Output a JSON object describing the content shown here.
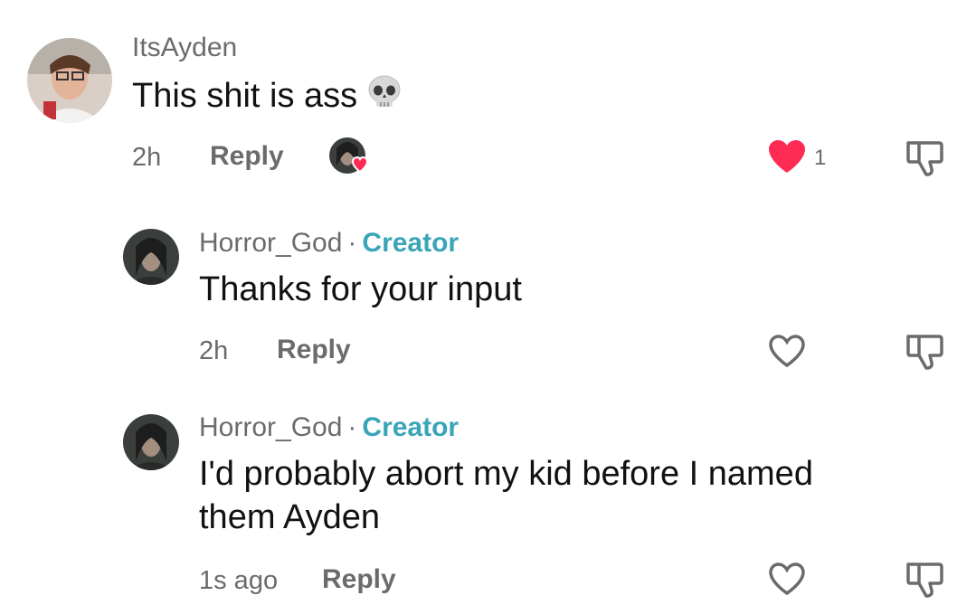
{
  "comments": [
    {
      "username": "ItsAyden",
      "text": "This shit is ass",
      "emoji_icon": "skull-emoji",
      "time": "2h",
      "reply_label": "Reply",
      "liked_by_creator": true,
      "liked": true,
      "like_count": "1",
      "colors": {
        "like": "#fe2c55"
      }
    },
    {
      "username": "Horror_God",
      "separator": "·",
      "badge": "Creator",
      "text": "Thanks for your input",
      "time": "2h",
      "reply_label": "Reply",
      "liked": false
    },
    {
      "username": "Horror_God",
      "separator": "·",
      "badge": "Creator",
      "text_line1": "I'd probably abort my kid before I named",
      "text_line2": "them Ayden",
      "time": "1s ago",
      "reply_label": "Reply",
      "liked": false
    }
  ],
  "colors": {
    "creator_badge": "#3aa4b9",
    "like_active": "#fe2c55",
    "meta": "#6b6b6b"
  }
}
